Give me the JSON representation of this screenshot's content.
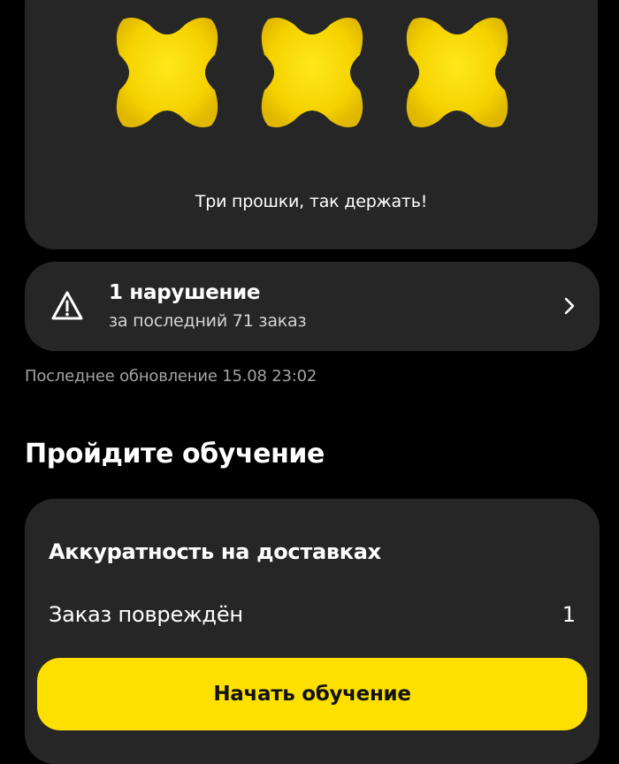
{
  "rating": {
    "stars_earned": 3,
    "stars": [
      {
        "icon": "yellow-star-icon"
      },
      {
        "icon": "yellow-star-icon"
      },
      {
        "icon": "yellow-star-icon"
      }
    ],
    "caption": "Три прошки, так держать!",
    "star_color": "#fde000"
  },
  "violations": {
    "icon": "warning-triangle-icon",
    "title": "1 нарушение",
    "subtitle": "за последний 71 заказ",
    "chevron_icon": "chevron-right-icon"
  },
  "last_update": "Последнее обновление 15.08 23:02",
  "training": {
    "section_title": "Пройдите обучение",
    "card_title": "Аккуратность на доставках",
    "row_label": "Заказ повреждён",
    "row_count": "1",
    "button_label": "Начать обучение",
    "accent_color": "#fde000"
  }
}
